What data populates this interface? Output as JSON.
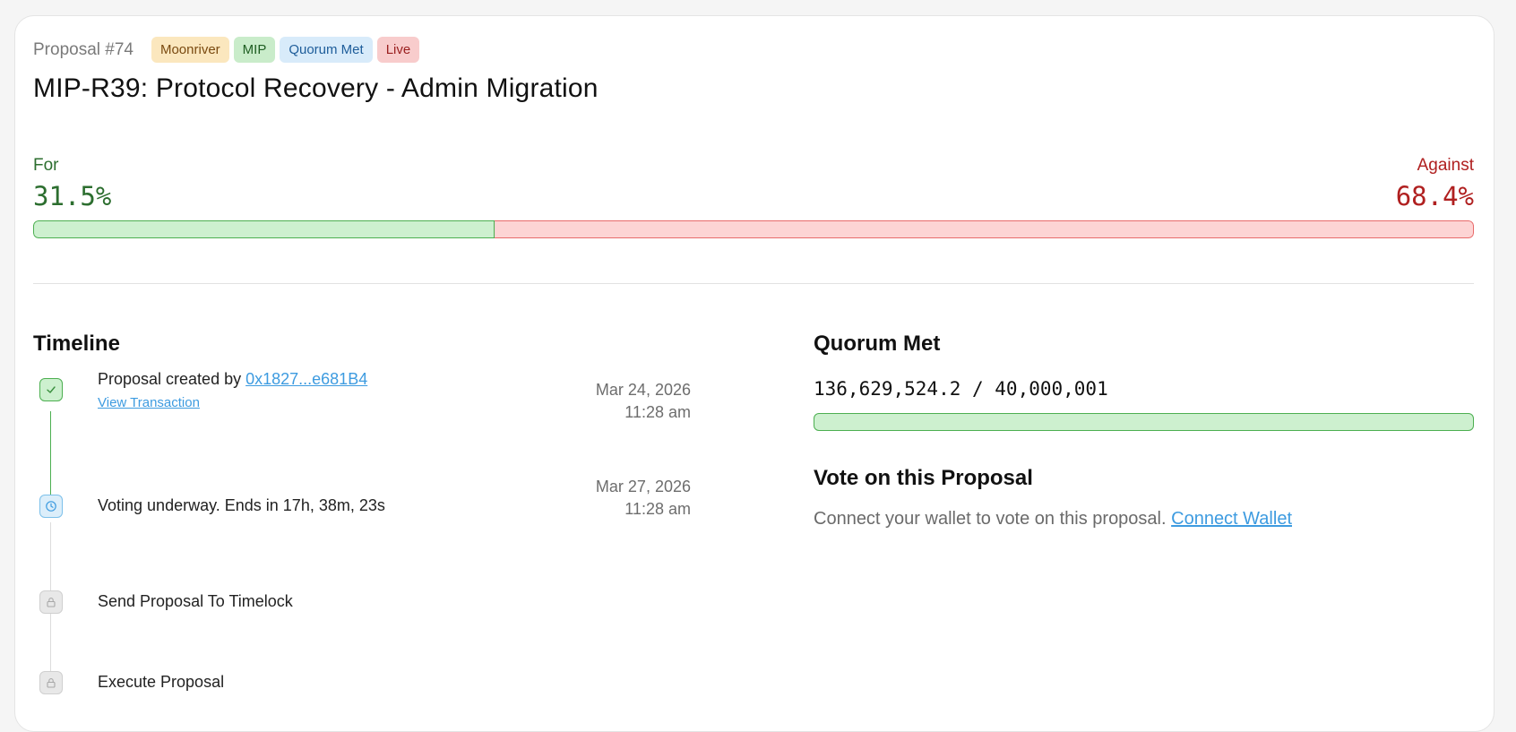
{
  "header": {
    "proposal_number": "Proposal #74",
    "badges": [
      "Moonriver",
      "MIP",
      "Quorum Met",
      "Live"
    ],
    "title": "MIP-R39: Protocol Recovery - Admin Migration"
  },
  "votes": {
    "for_label": "For",
    "for_percent": "31.5%",
    "against_label": "Against",
    "against_percent": "68.4%",
    "for_fraction": 0.32
  },
  "timeline": {
    "heading": "Timeline",
    "items": [
      {
        "text": "Proposal created by ",
        "link": "0x1827...e681B4",
        "sub_link": "View Transaction",
        "date": "Mar 24, 2026",
        "time": "11:28 am",
        "status": "done",
        "icon": "check-icon"
      },
      {
        "text": "Voting underway. Ends in 17h, 38m, 23s",
        "date": "Mar 27, 2026",
        "time": "11:28 am",
        "status": "live",
        "icon": "clock-icon"
      },
      {
        "text": "Send Proposal To Timelock",
        "status": "pending",
        "icon": "lock-icon"
      },
      {
        "text": "Execute Proposal",
        "status": "pending",
        "icon": "lock-icon"
      }
    ]
  },
  "quorum": {
    "heading": "Quorum Met",
    "value": "136,629,524.2 / 40,000,001",
    "fraction": 1.0
  },
  "vote_panel": {
    "heading": "Vote on this Proposal",
    "text": "Connect your wallet to vote on this proposal. ",
    "link": "Connect Wallet"
  },
  "colors": {
    "for": "#2c6e2f",
    "against": "#b02020",
    "link": "#3d9be0"
  }
}
